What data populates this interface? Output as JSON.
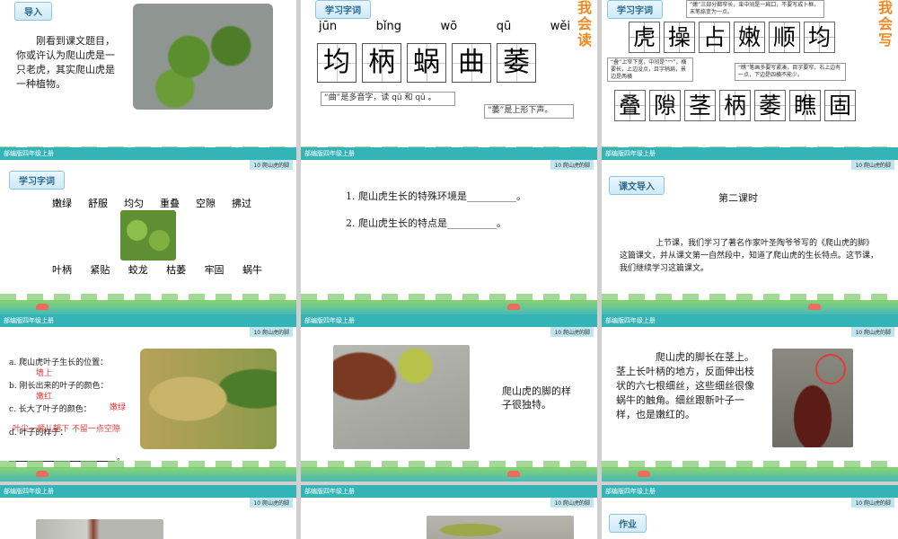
{
  "brand": "部编版四年级上册",
  "lesson": "10  爬山虎的脚",
  "s1": {
    "tag": "导入",
    "text": "刚看到课文题目，你或许认为爬山虎是一只老虎，其实爬山虎是一种植物。"
  },
  "s2": {
    "tag": "学习字词",
    "pinyin": [
      "jūn",
      "bǐng",
      "wō",
      "qū",
      "wěi"
    ],
    "chars": [
      "均",
      "柄",
      "蜗",
      "曲",
      "萎"
    ],
    "note1": "“曲”是多音字，读 qū 和 qǔ 。",
    "note2": "“萎”是上形下声。",
    "side": "我会读"
  },
  "s3": {
    "tag": "学习字词",
    "row1": [
      "虎",
      "操",
      "占",
      "嫩",
      "顺",
      "均"
    ],
    "row2": [
      "叠",
      "隙",
      "茎",
      "柄",
      "萎",
      "瞧",
      "固"
    ],
    "note_top": "“嫩”三部分都窄长，束中间是一扁口，不要写成卜框，末笔捺变为一点。",
    "note_left": "“叠”上窄下宽，中间是“冖”，横要长，上边没点，且字稍扁，景边是两横",
    "note_right": "“瞧”笔画多要写紧凑，目字要窄，右上边有一点，下边是四横不能少。",
    "side": "我会写"
  },
  "s4": {
    "tag": "学习字词",
    "row1": [
      "嫩绿",
      "舒服",
      "均匀",
      "重叠",
      "空隙",
      "拂过"
    ],
    "row2": [
      "叶柄",
      "紧贴",
      "蛟龙",
      "枯萎",
      "牢固",
      "蜗牛"
    ]
  },
  "s5": {
    "q1": "1. 爬山虎生长的特殊环境是__________。",
    "q2": "2. 爬山虎生长的特点是__________。"
  },
  "s6": {
    "tag": "课文导入",
    "title": "第二课时",
    "text": "上节课，我们学习了著名作家叶圣陶爷爷写的《爬山虎的脚》这篇课文，并从课文第一自然段中，知道了爬山虎的生长特点。这节课，我们继续学习这篇课文。"
  },
  "s7": {
    "a": "a. 爬山虎叶子生长的位置：",
    "a_ans": "墙上",
    "b": "b. 刚长出来的叶子的颜色：",
    "b_ans": "嫩红",
    "c": "c. 长大了叶子的颜色：",
    "c_ans": "嫩绿",
    "d": "d. 叶子的样子：",
    "d_ans": "叶尖一顺儿朝下 不留一点空隙",
    "end": "。"
  },
  "s8": {
    "text": "爬山虎的脚的样子很独特。"
  },
  "s9": {
    "text": "爬山虎的脚长在茎上。茎上长叶柄的地方，反面伸出枝状的六七根细丝，这些细丝很像蜗牛的触角。细丝跟新叶子一样，也是嫩红的。"
  },
  "s12": {
    "tag": "作业"
  },
  "colors": {
    "header": "#35b4b7",
    "side_title": "#f08a24",
    "answer": "#e03b3b"
  }
}
